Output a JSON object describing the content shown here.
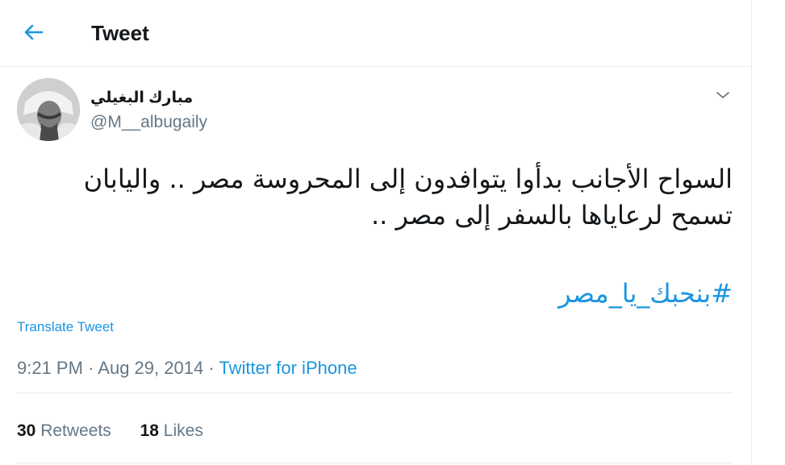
{
  "header": {
    "back_icon": "arrow-left-icon",
    "title": "Tweet"
  },
  "author": {
    "avatar_icon": "avatar",
    "name": "مبارك البغيلي",
    "handle": "@M__albugaily",
    "menu_icon": "chevron-down-icon"
  },
  "tweet": {
    "text_line1": "السواح الأجانب بدأوا يتوافدون إلى المحروسة مصر .. واليابان",
    "text_line2": "تسمح لرعاياها بالسفر إلى مصر ..",
    "hashtag": "#بنحبك_يا_مصر",
    "translate_label": "Translate Tweet",
    "time": "9:21 PM",
    "date": "Aug 29, 2014",
    "source": "Twitter for iPhone",
    "separator": "·"
  },
  "stats": {
    "retweets_count": "30",
    "retweets_label": "Retweets",
    "likes_count": "18",
    "likes_label": "Likes"
  },
  "colors": {
    "accent": "#1b95e0",
    "muted": "#657786",
    "text": "#14171a",
    "border": "#e6ecf0"
  }
}
